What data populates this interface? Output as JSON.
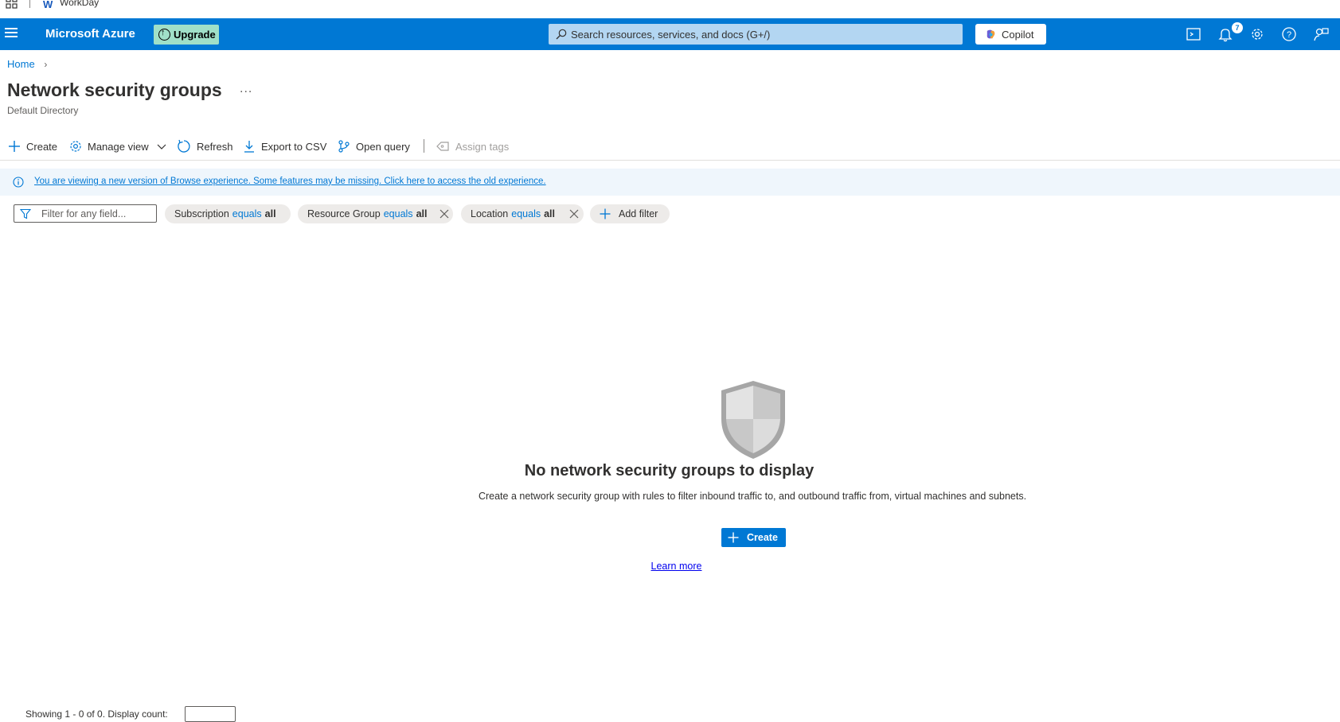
{
  "bookmarks": {
    "items": [
      {
        "label": "WorkDay"
      }
    ]
  },
  "topbar": {
    "brand": "Microsoft Azure",
    "upgrade_label": "Upgrade",
    "search_placeholder": "Search resources, services, and docs (G+/)",
    "copilot_label": "Copilot",
    "notification_count": "7",
    "accent_color": "#0078d4"
  },
  "breadcrumb": {
    "items": [
      {
        "label": "Home"
      }
    ]
  },
  "header": {
    "title": "Network security groups",
    "more": "...",
    "subtitle": "Default Directory"
  },
  "commands": [
    {
      "label": "Create",
      "icon": "plus-icon"
    },
    {
      "label": "Manage view",
      "icon": "gear-icon"
    },
    {
      "label": "Refresh",
      "icon": "refresh-icon"
    },
    {
      "label": "Export to CSV",
      "icon": "download-icon"
    },
    {
      "label": "Open query",
      "icon": "query-icon"
    },
    {
      "label": "Assign tags",
      "icon": "tag-icon",
      "disabled": true
    }
  ],
  "banner": {
    "text": "You are viewing a new version of Browse experience. Some features may be missing. Click here to access the old experience."
  },
  "filters": {
    "placeholder": "Filter for any field...",
    "pills": [
      {
        "field": "Subscription",
        "operator": "equals",
        "value": "all"
      },
      {
        "field": "Resource Group",
        "operator": "equals",
        "value": "all"
      },
      {
        "field": "Location",
        "operator": "equals",
        "value": "all"
      }
    ],
    "add_label": "Add filter"
  },
  "empty_state": {
    "title": "No network security groups to display",
    "description": "Create a network security group with rules to filter inbound traffic to, and outbound traffic from, virtual machines and subnets.",
    "create_label": "Create",
    "learn_more": "Learn more"
  },
  "footer": {
    "showing_text": "Showing 1 - 0 of 0. Display count:"
  }
}
